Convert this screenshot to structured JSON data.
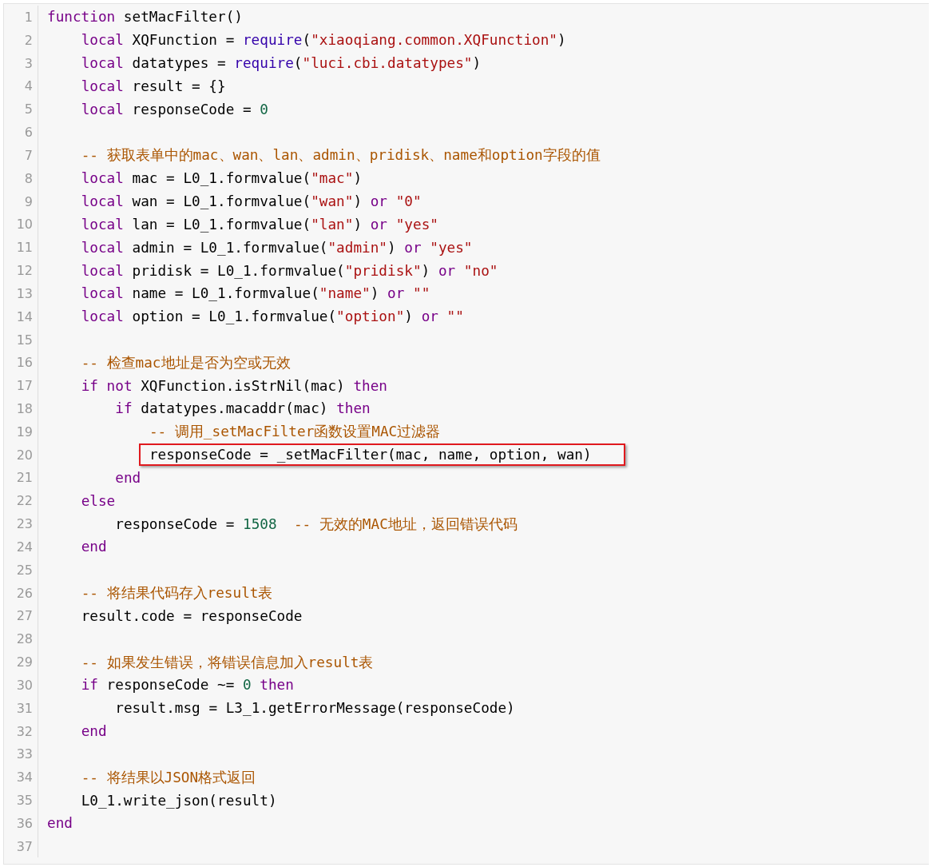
{
  "code_view": {
    "lines": [
      {
        "number": "1",
        "tokens": [
          {
            "kind": "keyword",
            "text": "function"
          },
          {
            "kind": "plain",
            "text": " setMacFilter()"
          }
        ],
        "children": [
          {
            "number": "2",
            "tokens": [
              {
                "kind": "keyword",
                "text": "local"
              },
              {
                "kind": "plain",
                "text": " XQFunction = "
              },
              {
                "kind": "builtin",
                "text": "require"
              },
              {
                "kind": "plain",
                "text": "("
              },
              {
                "kind": "string",
                "text": "\"xiaoqiang.common.XQFunction\""
              },
              {
                "kind": "plain",
                "text": ")"
              }
            ]
          },
          {
            "number": "3",
            "tokens": [
              {
                "kind": "keyword",
                "text": "local"
              },
              {
                "kind": "plain",
                "text": " datatypes = "
              },
              {
                "kind": "builtin",
                "text": "require"
              },
              {
                "kind": "plain",
                "text": "("
              },
              {
                "kind": "string",
                "text": "\"luci.cbi.datatypes\""
              },
              {
                "kind": "plain",
                "text": ")"
              }
            ]
          },
          {
            "number": "4",
            "tokens": [
              {
                "kind": "keyword",
                "text": "local"
              },
              {
                "kind": "plain",
                "text": " result = {}"
              }
            ]
          },
          {
            "number": "5",
            "tokens": [
              {
                "kind": "keyword",
                "text": "local"
              },
              {
                "kind": "plain",
                "text": " responseCode = "
              },
              {
                "kind": "number",
                "text": "0"
              }
            ]
          },
          {
            "number": "6"
          },
          {
            "number": "7",
            "tokens": [
              {
                "kind": "comment",
                "text": "-- 获取表单中的mac、wan、lan、admin、pridisk、name和option字段的值"
              }
            ]
          },
          {
            "number": "8",
            "tokens": [
              {
                "kind": "keyword",
                "text": "local"
              },
              {
                "kind": "plain",
                "text": " mac = L0_1.formvalue("
              },
              {
                "kind": "string",
                "text": "\"mac\""
              },
              {
                "kind": "plain",
                "text": ")"
              }
            ]
          },
          {
            "number": "9",
            "tokens": [
              {
                "kind": "keyword",
                "text": "local"
              },
              {
                "kind": "plain",
                "text": " wan = L0_1.formvalue("
              },
              {
                "kind": "string",
                "text": "\"wan\""
              },
              {
                "kind": "plain",
                "text": ") "
              },
              {
                "kind": "keyword",
                "text": "or"
              },
              {
                "kind": "string",
                "text": " \"0\""
              }
            ]
          },
          {
            "number": "10",
            "tokens": [
              {
                "kind": "keyword",
                "text": "local"
              },
              {
                "kind": "plain",
                "text": " lan = L0_1.formvalue("
              },
              {
                "kind": "string",
                "text": "\"lan\""
              },
              {
                "kind": "plain",
                "text": ") "
              },
              {
                "kind": "keyword",
                "text": "or"
              },
              {
                "kind": "string",
                "text": " \"yes\""
              }
            ]
          },
          {
            "number": "11",
            "tokens": [
              {
                "kind": "keyword",
                "text": "local"
              },
              {
                "kind": "plain",
                "text": " admin = L0_1.formvalue("
              },
              {
                "kind": "string",
                "text": "\"admin\""
              },
              {
                "kind": "plain",
                "text": ") "
              },
              {
                "kind": "keyword",
                "text": "or"
              },
              {
                "kind": "string",
                "text": " \"yes\""
              }
            ]
          },
          {
            "number": "12",
            "tokens": [
              {
                "kind": "keyword",
                "text": "local"
              },
              {
                "kind": "plain",
                "text": " pridisk = L0_1.formvalue("
              },
              {
                "kind": "string",
                "text": "\"pridisk\""
              },
              {
                "kind": "plain",
                "text": ") "
              },
              {
                "kind": "keyword",
                "text": "or"
              },
              {
                "kind": "string",
                "text": " \"no\""
              }
            ]
          },
          {
            "number": "13",
            "tokens": [
              {
                "kind": "keyword",
                "text": "local"
              },
              {
                "kind": "plain",
                "text": " name = L0_1.formvalue("
              },
              {
                "kind": "string",
                "text": "\"name\""
              },
              {
                "kind": "plain",
                "text": ") "
              },
              {
                "kind": "keyword",
                "text": "or"
              },
              {
                "kind": "string",
                "text": " \"\""
              }
            ]
          },
          {
            "number": "14",
            "tokens": [
              {
                "kind": "keyword",
                "text": "local"
              },
              {
                "kind": "plain",
                "text": " option = L0_1.formvalue("
              },
              {
                "kind": "string",
                "text": "\"option\""
              },
              {
                "kind": "plain",
                "text": ") "
              },
              {
                "kind": "keyword",
                "text": "or"
              },
              {
                "kind": "string",
                "text": " \"\""
              }
            ]
          },
          {
            "number": "15"
          },
          {
            "number": "16",
            "tokens": [
              {
                "kind": "comment",
                "text": "-- 检查mac地址是否为空或无效"
              }
            ]
          },
          {
            "number": "17",
            "tokens": [
              {
                "kind": "keyword",
                "text": "if"
              },
              {
                "kind": "keyword",
                "text": " not"
              },
              {
                "kind": "plain",
                "text": " XQFunction.isStrNil(mac) "
              },
              {
                "kind": "keyword",
                "text": "then"
              }
            ],
            "children": [
              {
                "number": "18",
                "tokens": [
                  {
                    "kind": "keyword",
                    "text": "if"
                  },
                  {
                    "kind": "plain",
                    "text": " datatypes.macaddr(mac) "
                  },
                  {
                    "kind": "keyword",
                    "text": "then"
                  }
                ],
                "children": [
                  {
                    "number": "19",
                    "tokens": [
                      {
                        "kind": "comment",
                        "text": "-- 调用_setMacFilter函数设置MAC过滤器"
                      }
                    ]
                  },
                  {
                    "number": "20",
                    "highlighted": true,
                    "tokens": [
                      {
                        "kind": "plain",
                        "text": "responseCode = _setMacFilter(mac, name, option, wan)"
                      }
                    ]
                  }
                ]
              },
              {
                "number": "21",
                "tokens": [
                  {
                    "kind": "keyword",
                    "text": "end"
                  }
                ]
              }
            ]
          },
          {
            "number": "22",
            "tokens": [
              {
                "kind": "keyword",
                "text": "else"
              }
            ],
            "children": [
              {
                "number": "23",
                "tokens": [
                  {
                    "kind": "plain",
                    "text": "responseCode = "
                  },
                  {
                    "kind": "number",
                    "text": "1508"
                  },
                  {
                    "kind": "comment",
                    "text": "  -- 无效的MAC地址，返回错误代码"
                  }
                ]
              }
            ]
          },
          {
            "number": "24",
            "tokens": [
              {
                "kind": "keyword",
                "text": "end"
              }
            ]
          },
          {
            "number": "25"
          },
          {
            "number": "26",
            "tokens": [
              {
                "kind": "comment",
                "text": "-- 将结果代码存入result表"
              }
            ]
          },
          {
            "number": "27",
            "tokens": [
              {
                "kind": "plain",
                "text": "result.code = responseCode"
              }
            ]
          },
          {
            "number": "28"
          },
          {
            "number": "29",
            "tokens": [
              {
                "kind": "comment",
                "text": "-- 如果发生错误，将错误信息加入result表"
              }
            ]
          },
          {
            "number": "30",
            "tokens": [
              {
                "kind": "keyword",
                "text": "if"
              },
              {
                "kind": "plain",
                "text": " responseCode ~= "
              },
              {
                "kind": "number",
                "text": "0"
              },
              {
                "kind": "keyword",
                "text": " then"
              }
            ],
            "children": [
              {
                "number": "31",
                "tokens": [
                  {
                    "kind": "plain",
                    "text": "result.msg = L3_1.getErrorMessage(responseCode)"
                  }
                ]
              }
            ]
          },
          {
            "number": "32",
            "tokens": [
              {
                "kind": "keyword",
                "text": "end"
              }
            ]
          },
          {
            "number": "33"
          },
          {
            "number": "34",
            "tokens": [
              {
                "kind": "comment",
                "text": "-- 将结果以JSON格式返回"
              }
            ]
          },
          {
            "number": "35",
            "tokens": [
              {
                "kind": "plain",
                "text": "L0_1.write_json(result)"
              }
            ]
          }
        ]
      },
      {
        "number": "36",
        "tokens": [
          {
            "kind": "keyword",
            "text": "end"
          }
        ]
      },
      {
        "number": "37"
      }
    ]
  }
}
